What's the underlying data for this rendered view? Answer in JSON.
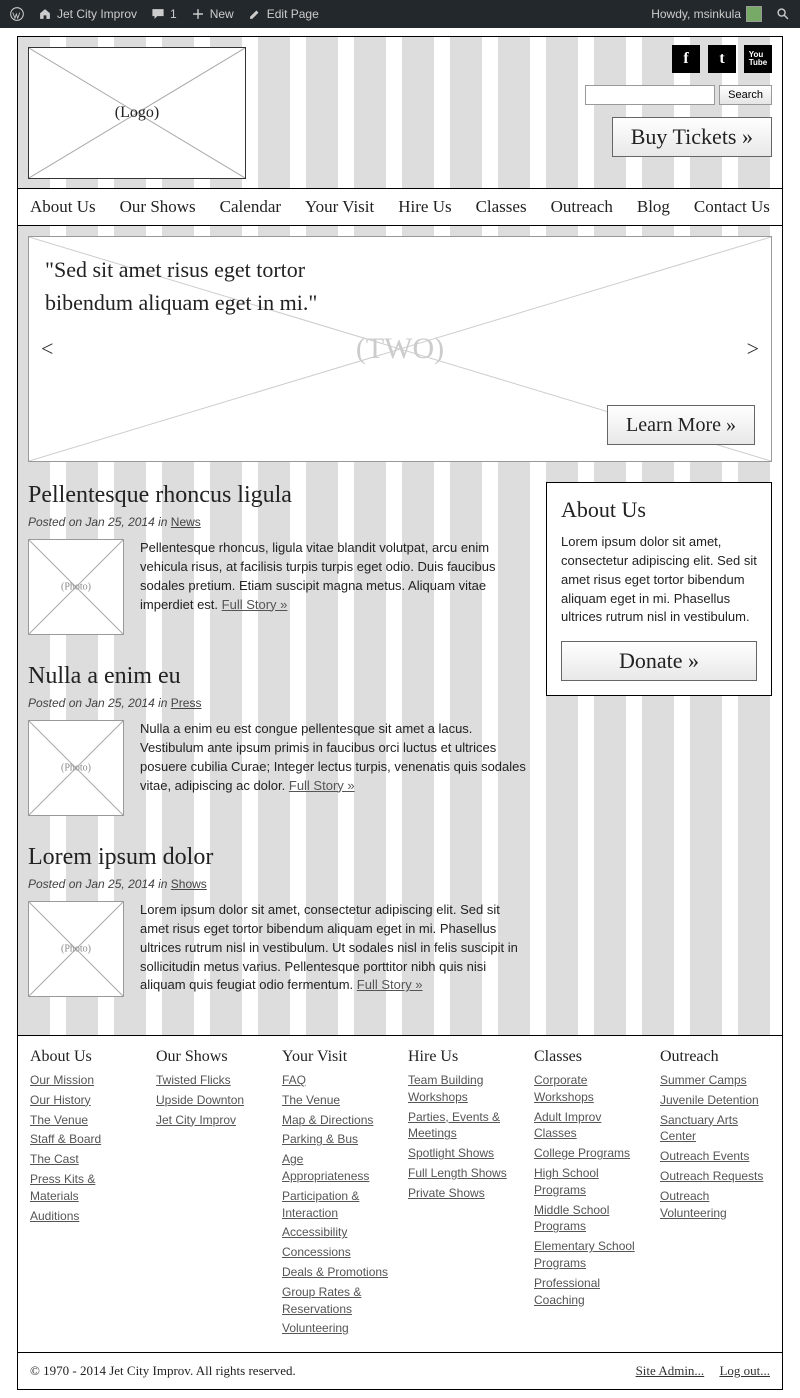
{
  "adminbar": {
    "site": "Jet City Improv",
    "comments": "1",
    "new": "New",
    "edit": "Edit Page",
    "howdy": "Howdy, msinkula"
  },
  "header": {
    "logo": "(Logo)",
    "search_btn": "Search",
    "buy": "Buy Tickets »"
  },
  "nav": [
    "About Us",
    "Our Shows",
    "Calendar",
    "Your Visit",
    "Hire Us",
    "Classes",
    "Outreach",
    "Blog",
    "Contact Us"
  ],
  "hero": {
    "bg": "(TWO)",
    "quote": "\"Sed sit amet risus eget tortor bibendum aliquam eget in mi.\"",
    "learn": "Learn More »",
    "prev": "<",
    "next": ">"
  },
  "posts": [
    {
      "title": "Pellentesque rhoncus ligula",
      "meta_pre": "Posted on Jan 25, 2014 in ",
      "cat": "News",
      "thumb": "(Photo)",
      "excerpt": "Pellentesque rhoncus, ligula vitae blandit volutpat, arcu enim vehicula risus, at facilisis turpis turpis eget odio. Duis faucibus sodales pretium. Etiam suscipit magna metus. Aliquam vitae imperdiet est. ",
      "full": "Full Story »"
    },
    {
      "title": "Nulla a enim eu",
      "meta_pre": "Posted on Jan 25, 2014 in ",
      "cat": "Press",
      "thumb": "(Photo)",
      "excerpt": "Nulla a enim eu est congue pellentesque sit amet a lacus. Vestibulum ante ipsum primis in faucibus orci luctus et ultrices posuere cubilia Curae; Integer lectus turpis, venenatis quis sodales vitae, adipiscing ac dolor. ",
      "full": "Full Story »"
    },
    {
      "title": "Lorem ipsum dolor",
      "meta_pre": "Posted on Jan 25, 2014 in ",
      "cat": "Shows",
      "thumb": "(Photo)",
      "excerpt": "Lorem ipsum dolor sit amet, consectetur adipiscing elit. Sed sit amet risus eget tortor bibendum aliquam eget in mi. Phasellus ultrices rutrum nisl in vestibulum. Ut sodales nisl in felis suscipit in sollicitudin metus varius. Pellentesque porttitor nibh quis nisi aliquam quis feugiat odio fermentum. ",
      "full": "Full Story »"
    }
  ],
  "sidebar": {
    "title": "About Us",
    "text": "Lorem ipsum dolor sit amet, consectetur adipiscing elit. Sed sit amet risus eget tortor bibendum aliquam eget in mi. Phasellus ultrices rutrum nisl in vestibulum.",
    "donate": "Donate »"
  },
  "footer": [
    {
      "h": "About Us",
      "links": [
        "Our Mission",
        "Our History",
        "The Venue",
        "Staff & Board",
        "The Cast",
        "Press Kits & Materials",
        "Auditions"
      ]
    },
    {
      "h": "Our Shows",
      "links": [
        "Twisted Flicks",
        "Upside Downton",
        "Jet City Improv"
      ]
    },
    {
      "h": "Your Visit",
      "links": [
        "FAQ",
        "The Venue",
        "Map & Directions",
        "Parking & Bus",
        "Age Appropriateness",
        "Participation & Interaction",
        "Accessibility",
        "Concessions",
        "Deals & Promotions",
        "Group Rates & Reservations",
        "Volunteering"
      ]
    },
    {
      "h": "Hire Us",
      "links": [
        "Team Building Workshops",
        "Parties, Events & Meetings",
        "Spotlight Shows",
        "Full Length Shows",
        "Private Shows"
      ]
    },
    {
      "h": "Classes",
      "links": [
        "Corporate Workshops",
        "Adult Improv Classes",
        "College Programs",
        "High School Programs",
        "Middle School Programs",
        "Elementary School Programs",
        "Professional Coaching"
      ]
    },
    {
      "h": "Outreach",
      "links": [
        "Summer Camps",
        "Juvenile Detention",
        "Sanctuary Arts Center",
        "Outreach Events",
        "Outreach Requests",
        "Outreach Volunteering"
      ]
    }
  ],
  "copy": {
    "text": "© 1970 - 2014 Jet City Improv. All rights reserved.",
    "admin": "Site Admin...",
    "logout": "Log out..."
  }
}
